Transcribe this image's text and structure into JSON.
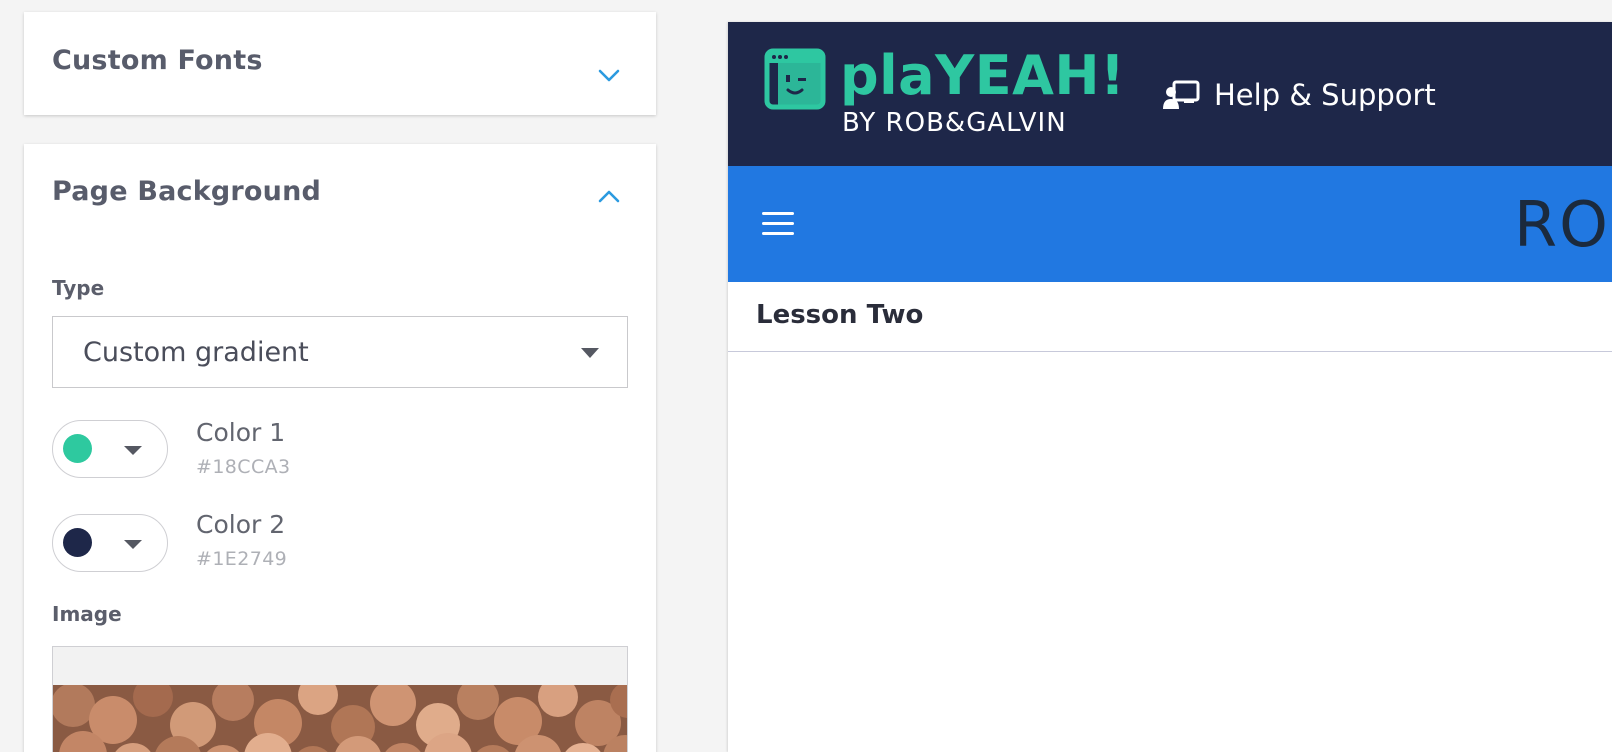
{
  "sidebar": {
    "custom_fonts": {
      "title": "Custom Fonts",
      "icon": "chevron-down-icon"
    },
    "page_background": {
      "title": "Page Background",
      "icon": "chevron-up-icon",
      "type_label": "Type",
      "type_value": "Custom gradient",
      "color1": {
        "name": "Color 1",
        "hex": "#18CCA3",
        "swatch": "#2ec99f"
      },
      "color2": {
        "name": "Color 2",
        "hex": "#1E2749",
        "swatch": "#1e2749"
      },
      "image_label": "Image"
    }
  },
  "preview": {
    "brand": {
      "name": "plaYEAH!",
      "sub": "BY ROB&GALVIN",
      "accent": "#2ec7a1"
    },
    "help_link": "Help & Support",
    "nav_title": "RO",
    "lesson_title": "Lesson Two",
    "colors": {
      "topbar": "#1e2749",
      "navbar": "#2178e1"
    }
  }
}
